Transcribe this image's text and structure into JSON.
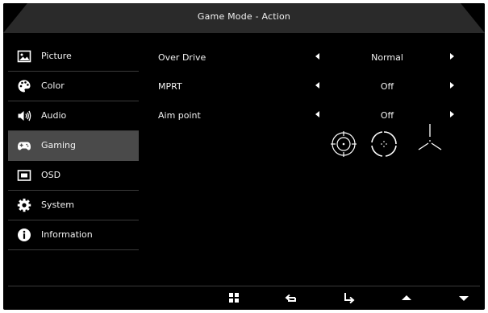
{
  "title": "Game Mode - Action",
  "sidebar": {
    "items": [
      {
        "label": "Picture",
        "icon": "picture-icon"
      },
      {
        "label": "Color",
        "icon": "palette-icon"
      },
      {
        "label": "Audio",
        "icon": "speaker-icon"
      },
      {
        "label": "Gaming",
        "icon": "gamepad-icon",
        "selected": true
      },
      {
        "label": "OSD",
        "icon": "osd-icon"
      },
      {
        "label": "System",
        "icon": "gear-icon"
      },
      {
        "label": "Information",
        "icon": "info-icon"
      }
    ]
  },
  "settings": [
    {
      "name": "Over Drive",
      "value": "Normal"
    },
    {
      "name": "MPRT",
      "value": "Off"
    },
    {
      "name": "Aim point",
      "value": "Off"
    }
  ],
  "aim_point_styles": [
    "crosshair-circle-icon",
    "crosshair-dot-circle-icon",
    "crosshair-tri-icon"
  ],
  "footer": {
    "buttons": [
      "menu-grid-icon",
      "back-icon",
      "enter-icon",
      "up-icon",
      "down-icon"
    ]
  },
  "colors": {
    "background": "#000000",
    "titlebar": "#2a2a2a",
    "selected": "#4a4a4a",
    "divider": "#3a3a3a",
    "text": "#f2f2f2"
  }
}
